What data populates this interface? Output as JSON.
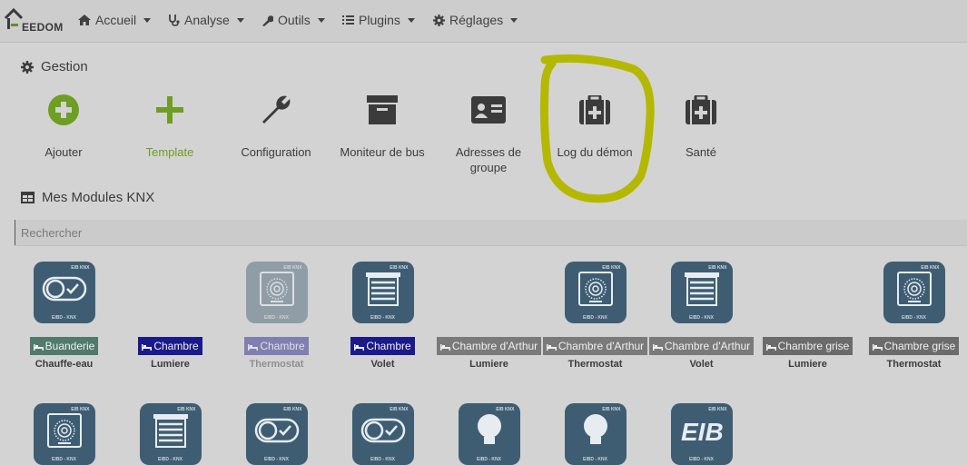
{
  "nav": {
    "logo_text": "EEDOM",
    "items": [
      {
        "label": "Accueil",
        "icon": "home-icon"
      },
      {
        "label": "Analyse",
        "icon": "stethoscope-icon"
      },
      {
        "label": "Outils",
        "icon": "wrench-icon"
      },
      {
        "label": "Plugins",
        "icon": "list-icon"
      },
      {
        "label": "Réglages",
        "icon": "gear-icon"
      }
    ]
  },
  "gestion": {
    "title": "Gestion",
    "tiles": [
      {
        "label": "Ajouter",
        "icon": "plus-circle-icon"
      },
      {
        "label": "Template",
        "icon": "plus-icon"
      },
      {
        "label": "Configuration",
        "icon": "wrench-icon"
      },
      {
        "label": "Moniteur de bus",
        "icon": "archive-box-icon"
      },
      {
        "label": "Adresses de groupe",
        "icon": "id-card-icon"
      },
      {
        "label": "Log du démon",
        "icon": "medkit-icon"
      },
      {
        "label": "Santé",
        "icon": "medkit-icon"
      }
    ]
  },
  "modules": {
    "title": "Mes Modules KNX",
    "search_placeholder": "Rechercher",
    "image_brand": "EIBD - KNX",
    "image_corner": "EIB KNX",
    "row1": [
      {
        "room": "Buanderie",
        "name": "Chauffe-eau",
        "badge_color": "#4f7a6c",
        "icon": "toggle-icon"
      },
      {
        "room": "Chambre",
        "name": "Lumiere",
        "badge_color": "#1a1a8c",
        "icon": "none"
      },
      {
        "room": "Chambre",
        "name": "Thermostat",
        "badge_color": "#1a1a8c",
        "icon": "thermostat-icon"
      },
      {
        "room": "Chambre",
        "name": "Volet",
        "badge_color": "#1a1a8c",
        "icon": "shutter-icon"
      },
      {
        "room": "Chambre d'Arthur",
        "name": "Lumiere",
        "badge_color": "#7a7a7a",
        "icon": "none"
      },
      {
        "room": "Chambre d'Arthur",
        "name": "Thermostat",
        "badge_color": "#7a7a7a",
        "icon": "thermostat-icon"
      },
      {
        "room": "Chambre d'Arthur",
        "name": "Volet",
        "badge_color": "#7a7a7a",
        "icon": "shutter-icon"
      },
      {
        "room": "Chambre grise",
        "name": "Lumiere",
        "badge_color": "#6b6b6b",
        "icon": "none"
      },
      {
        "room": "Chambre grise",
        "name": "Thermostat",
        "badge_color": "#6b6b6b",
        "icon": "thermostat-icon"
      }
    ],
    "row2_icons": [
      "thermostat-icon",
      "shutter-icon",
      "toggle-icon",
      "toggle-icon",
      "bulb-icon",
      "bulb-icon",
      "eib-logo-icon"
    ]
  },
  "colors": {
    "accent_green": "#6e9e22",
    "module_blue": "#3f5d72",
    "highlight_yellow": "#b5b800"
  }
}
